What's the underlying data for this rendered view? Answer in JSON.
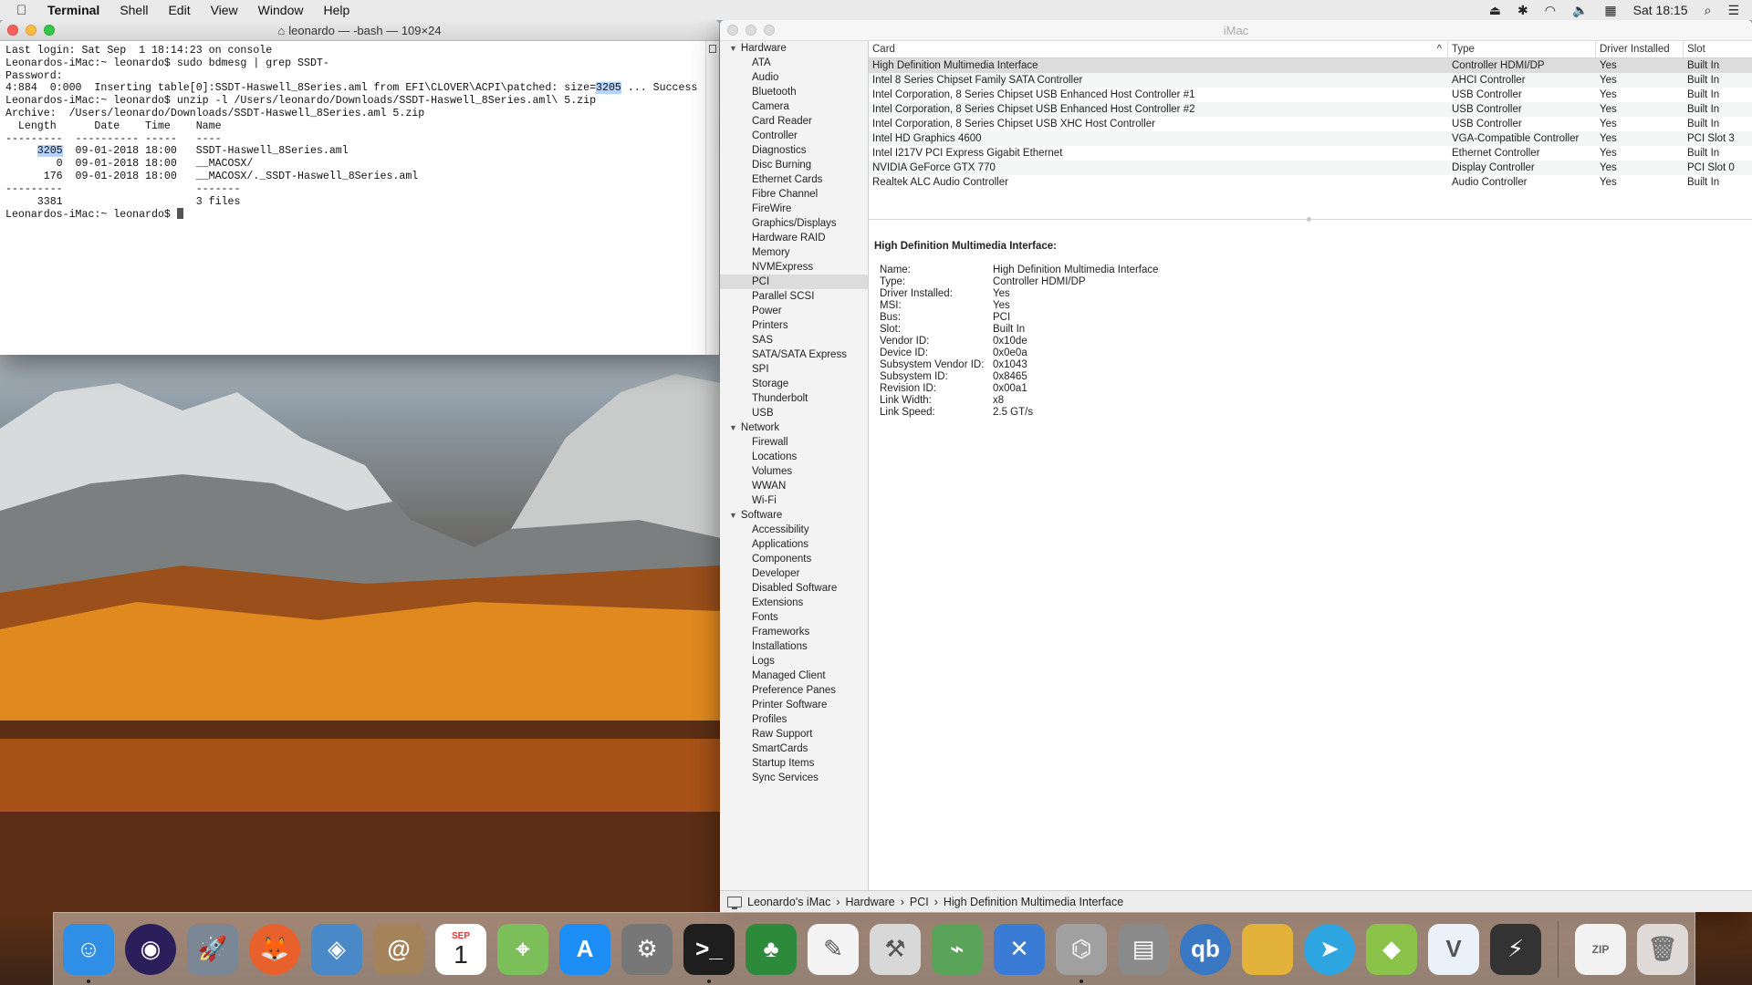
{
  "menubar": {
    "app": "Terminal",
    "items": [
      "Shell",
      "Edit",
      "View",
      "Window",
      "Help"
    ],
    "clock": "Sat 18:15"
  },
  "terminal": {
    "title": "leonardo — -bash — 109×24",
    "lines": [
      "Last login: Sat Sep  1 18:14:23 on console",
      "Leonardos-iMac:~ leonardo$ sudo bdmesg | grep SSDT-",
      "Password:",
      "4:884  0:000  Inserting table[0]:SSDT-Haswell_8Series.aml from EFI\\CLOVER\\ACPI\\patched: size=",
      "3205",
      " ... Success",
      "Leonardos-iMac:~ leonardo$ unzip -l /Users/leonardo/Downloads/SSDT-Haswell_8Series.aml\\ 5.zip",
      "Archive:  /Users/leonardo/Downloads/SSDT-Haswell_8Series.aml 5.zip",
      "  Length      Date    Time    Name",
      "---------  ---------- -----   ----",
      "     ",
      "3205",
      "  09-01-2018 18:00   SSDT-Haswell_8Series.aml",
      "        0  09-01-2018 18:00   __MACOSX/",
      "      176  09-01-2018 18:00   __MACOSX/._SSDT-Haswell_8Series.aml",
      "---------                     -------",
      "     3381                     3 files",
      "Leonardos-iMac:~ leonardo$ "
    ]
  },
  "sysinfo": {
    "title": "iMac",
    "sidebar": [
      {
        "label": "Hardware",
        "group": true
      },
      {
        "label": "ATA"
      },
      {
        "label": "Audio"
      },
      {
        "label": "Bluetooth"
      },
      {
        "label": "Camera"
      },
      {
        "label": "Card Reader"
      },
      {
        "label": "Controller"
      },
      {
        "label": "Diagnostics"
      },
      {
        "label": "Disc Burning"
      },
      {
        "label": "Ethernet Cards"
      },
      {
        "label": "Fibre Channel"
      },
      {
        "label": "FireWire"
      },
      {
        "label": "Graphics/Displays"
      },
      {
        "label": "Hardware RAID"
      },
      {
        "label": "Memory"
      },
      {
        "label": "NVMExpress"
      },
      {
        "label": "PCI",
        "selected": true
      },
      {
        "label": "Parallel SCSI"
      },
      {
        "label": "Power"
      },
      {
        "label": "Printers"
      },
      {
        "label": "SAS"
      },
      {
        "label": "SATA/SATA Express"
      },
      {
        "label": "SPI"
      },
      {
        "label": "Storage"
      },
      {
        "label": "Thunderbolt"
      },
      {
        "label": "USB"
      },
      {
        "label": "Network",
        "group": true
      },
      {
        "label": "Firewall"
      },
      {
        "label": "Locations"
      },
      {
        "label": "Volumes"
      },
      {
        "label": "WWAN"
      },
      {
        "label": "Wi-Fi"
      },
      {
        "label": "Software",
        "group": true
      },
      {
        "label": "Accessibility"
      },
      {
        "label": "Applications"
      },
      {
        "label": "Components"
      },
      {
        "label": "Developer"
      },
      {
        "label": "Disabled Software"
      },
      {
        "label": "Extensions"
      },
      {
        "label": "Fonts"
      },
      {
        "label": "Frameworks"
      },
      {
        "label": "Installations"
      },
      {
        "label": "Logs"
      },
      {
        "label": "Managed Client"
      },
      {
        "label": "Preference Panes"
      },
      {
        "label": "Printer Software"
      },
      {
        "label": "Profiles"
      },
      {
        "label": "Raw Support"
      },
      {
        "label": "SmartCards"
      },
      {
        "label": "Startup Items"
      },
      {
        "label": "Sync Services"
      }
    ],
    "table": {
      "headers": [
        "Card",
        "Type",
        "Driver Installed",
        "Slot"
      ],
      "rows": [
        [
          "High Definition Multimedia Interface",
          "Controller HDMI/DP",
          "Yes",
          "Built In"
        ],
        [
          "Intel 8 Series Chipset Family SATA Controller",
          "AHCI Controller",
          "Yes",
          "Built In"
        ],
        [
          "Intel Corporation, 8 Series Chipset USB Enhanced Host Controller #1",
          "USB Controller",
          "Yes",
          "Built In"
        ],
        [
          "Intel Corporation, 8 Series Chipset USB Enhanced Host Controller #2",
          "USB Controller",
          "Yes",
          "Built In"
        ],
        [
          "Intel Corporation, 8 Series Chipset USB XHC Host Controller",
          "USB Controller",
          "Yes",
          "Built In"
        ],
        [
          "Intel HD Graphics 4600",
          "VGA-Compatible Controller",
          "Yes",
          "PCI Slot 3"
        ],
        [
          "Intel I217V PCI Express Gigabit Ethernet",
          "Ethernet Controller",
          "Yes",
          "Built In"
        ],
        [
          "NVIDIA GeForce GTX 770",
          "Display Controller",
          "Yes",
          "PCI Slot 0"
        ],
        [
          "Realtek ALC Audio Controller",
          "Audio Controller",
          "Yes",
          "Built In"
        ]
      ]
    },
    "detail": {
      "heading": "High Definition Multimedia Interface:",
      "fields": [
        [
          "Name:",
          "High Definition Multimedia Interface"
        ],
        [
          "Type:",
          "Controller HDMI/DP"
        ],
        [
          "Driver Installed:",
          "Yes"
        ],
        [
          "MSI:",
          "Yes"
        ],
        [
          "Bus:",
          "PCI"
        ],
        [
          "Slot:",
          "Built In"
        ],
        [
          "Vendor ID:",
          "0x10de"
        ],
        [
          "Device ID:",
          "0x0e0a"
        ],
        [
          "Subsystem Vendor ID:",
          "0x1043"
        ],
        [
          "Subsystem ID:",
          "0x8465"
        ],
        [
          "Revision ID:",
          "0x00a1"
        ],
        [
          "Link Width:",
          "x8"
        ],
        [
          "Link Speed:",
          "2.5 GT/s"
        ]
      ]
    },
    "path": [
      "Leonardo's iMac",
      "Hardware",
      "PCI",
      "High Definition Multimedia Interface"
    ],
    "path_sep": "›"
  },
  "dock": {
    "calendar_month": "SEP",
    "calendar_day": "1",
    "qbit_label": "qb",
    "zip_label": "ZIP",
    "apps": [
      {
        "name": "finder",
        "color": "#2f8ee6"
      },
      {
        "name": "siri",
        "color": "#2a1f5a"
      },
      {
        "name": "launchpad",
        "color": "#7b8794"
      },
      {
        "name": "firefox",
        "color": "#e8612c"
      },
      {
        "name": "preview",
        "color": "#4a89c8"
      },
      {
        "name": "contacts",
        "color": "#a4825a"
      },
      {
        "name": "calendar",
        "color": "#ffffff"
      },
      {
        "name": "maps",
        "color": "#7cbf5a"
      },
      {
        "name": "app-store",
        "color": "#1c8ef5"
      },
      {
        "name": "system-preferences",
        "color": "#777777"
      },
      {
        "name": "terminal",
        "color": "#1e1e1e"
      },
      {
        "name": "clover",
        "color": "#2c8a3a"
      },
      {
        "name": "textedit",
        "color": "#f4f4f4"
      },
      {
        "name": "xcode",
        "color": "#d8d8d8"
      },
      {
        "name": "maciasl",
        "color": "#5aa45a"
      },
      {
        "name": "utility",
        "color": "#3a7bd5"
      },
      {
        "name": "ioreg",
        "color": "#a0a0a0"
      },
      {
        "name": "calculator",
        "color": "#8a8a8a"
      },
      {
        "name": "qbittorrent",
        "color": "#3b78c4"
      },
      {
        "name": "archive",
        "color": "#e2b23a"
      },
      {
        "name": "telegram",
        "color": "#2ca5e0"
      },
      {
        "name": "android-file-transfer",
        "color": "#8bc34a"
      },
      {
        "name": "vectr",
        "color": "#eaf1f8"
      },
      {
        "name": "bolt",
        "color": "#333333"
      }
    ]
  }
}
